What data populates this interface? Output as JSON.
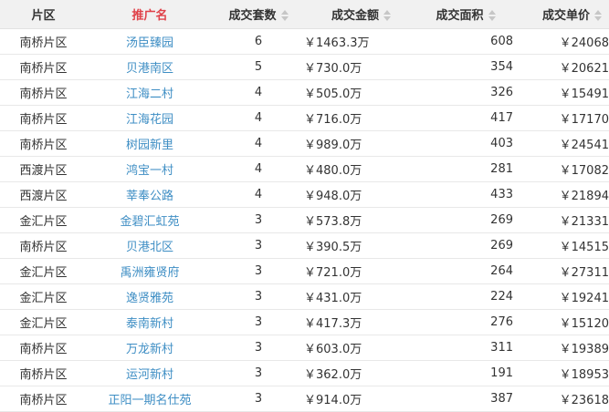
{
  "header": {
    "district": "片区",
    "name": "推广名",
    "count": "成交套数",
    "amount": "成交金额",
    "area": "成交面积",
    "price": "成交单价"
  },
  "sort_icon": "sort-arrows-icon",
  "colors": {
    "header_bg": "#f1f1f1",
    "active_header_text": "#e0424a",
    "link": "#3e8ec4",
    "sort_arrow": "#c6c6c6"
  },
  "rows": [
    {
      "district": "南桥片区",
      "name": "汤臣臻园",
      "count": "6",
      "amount": "￥1463.3万",
      "area": "608",
      "price": "￥24068"
    },
    {
      "district": "南桥片区",
      "name": "贝港南区",
      "count": "5",
      "amount": "￥730.0万",
      "area": "354",
      "price": "￥20621"
    },
    {
      "district": "南桥片区",
      "name": "江海二村",
      "count": "4",
      "amount": "￥505.0万",
      "area": "326",
      "price": "￥15491"
    },
    {
      "district": "南桥片区",
      "name": "江海花园",
      "count": "4",
      "amount": "￥716.0万",
      "area": "417",
      "price": "￥17170"
    },
    {
      "district": "南桥片区",
      "name": "树园新里",
      "count": "4",
      "amount": "￥989.0万",
      "area": "403",
      "price": "￥24541"
    },
    {
      "district": "西渡片区",
      "name": "鸿宝一村",
      "count": "4",
      "amount": "￥480.0万",
      "area": "281",
      "price": "￥17082"
    },
    {
      "district": "西渡片区",
      "name": "莘奉公路",
      "count": "4",
      "amount": "￥948.0万",
      "area": "433",
      "price": "￥21894"
    },
    {
      "district": "金汇片区",
      "name": "金碧汇虹苑",
      "count": "3",
      "amount": "￥573.8万",
      "area": "269",
      "price": "￥21331"
    },
    {
      "district": "南桥片区",
      "name": "贝港北区",
      "count": "3",
      "amount": "￥390.5万",
      "area": "269",
      "price": "￥14515"
    },
    {
      "district": "金汇片区",
      "name": "禹洲雍贤府",
      "count": "3",
      "amount": "￥721.0万",
      "area": "264",
      "price": "￥27311"
    },
    {
      "district": "金汇片区",
      "name": "逸贤雅苑",
      "count": "3",
      "amount": "￥431.0万",
      "area": "224",
      "price": "￥19241"
    },
    {
      "district": "金汇片区",
      "name": "泰南新村",
      "count": "3",
      "amount": "￥417.3万",
      "area": "276",
      "price": "￥15120"
    },
    {
      "district": "南桥片区",
      "name": "万龙新村",
      "count": "3",
      "amount": "￥603.0万",
      "area": "311",
      "price": "￥19389"
    },
    {
      "district": "南桥片区",
      "name": "运河新村",
      "count": "3",
      "amount": "￥362.0万",
      "area": "191",
      "price": "￥18953"
    },
    {
      "district": "南桥片区",
      "name": "正阳一期名仕苑",
      "count": "3",
      "amount": "￥914.0万",
      "area": "387",
      "price": "￥23618"
    }
  ]
}
